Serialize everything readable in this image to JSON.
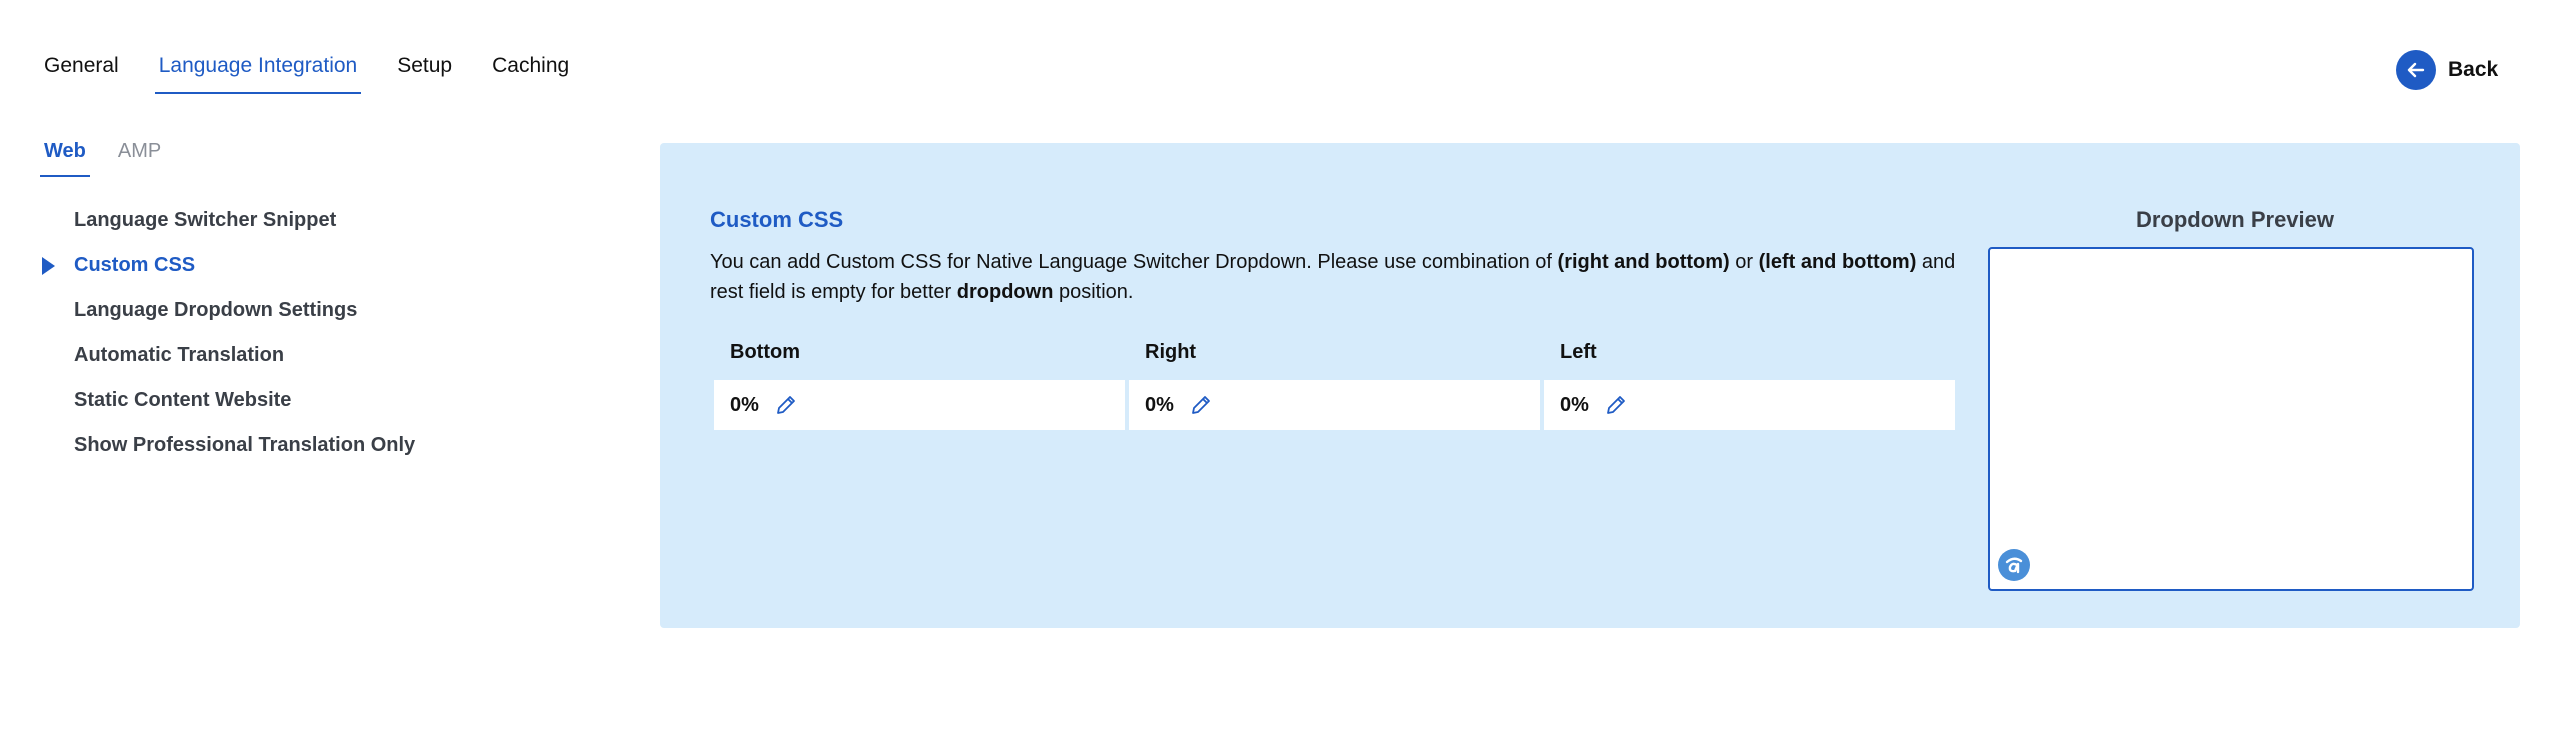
{
  "top_tabs": [
    {
      "label": "General",
      "active": false
    },
    {
      "label": "Language Integration",
      "active": true
    },
    {
      "label": "Setup",
      "active": false
    },
    {
      "label": "Caching",
      "active": false
    }
  ],
  "back": {
    "label": "Back",
    "icon": "arrow-left-icon"
  },
  "sub_tabs": [
    {
      "label": "Web",
      "active": true
    },
    {
      "label": "AMP",
      "active": false
    }
  ],
  "side_menu": [
    {
      "label": "Language Switcher Snippet",
      "active": false
    },
    {
      "label": "Custom CSS",
      "active": true
    },
    {
      "label": "Language Dropdown Settings",
      "active": false
    },
    {
      "label": "Automatic Translation",
      "active": false
    },
    {
      "label": "Static Content Website",
      "active": false
    },
    {
      "label": "Show Professional Translation Only",
      "active": false
    }
  ],
  "custom_css": {
    "title": "Custom CSS",
    "description": {
      "t1": "You can add Custom CSS for Native Language Switcher Dropdown. Please use combination of ",
      "b1": "(right and bottom)",
      "t2": " or ",
      "b2": "(left and bottom)",
      "t3": " and rest field is empty for better ",
      "b3": "dropdown",
      "t4": " position."
    },
    "fields": [
      {
        "label": "Bottom",
        "value": "0%"
      },
      {
        "label": "Right",
        "value": "0%"
      },
      {
        "label": "Left",
        "value": "0%"
      }
    ]
  },
  "preview": {
    "title": "Dropdown Preview",
    "logo_icon": "language-switcher-logo-icon"
  },
  "colors": {
    "accent": "#1f5bc4",
    "panel_bg": "#d6ebfb",
    "muted": "#8a8f98"
  }
}
